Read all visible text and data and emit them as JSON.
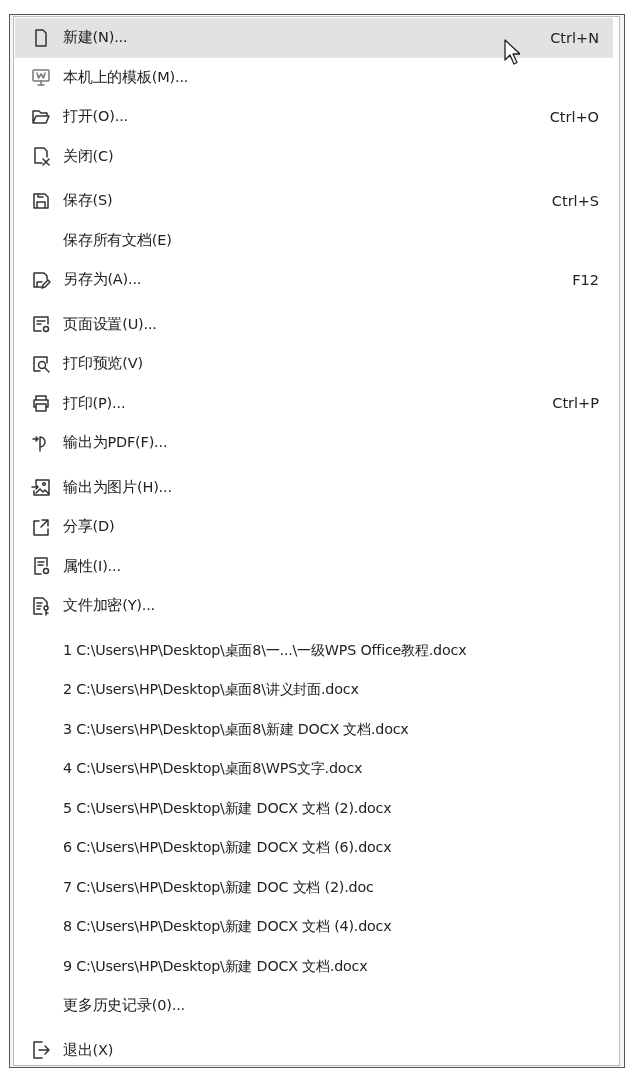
{
  "menu": {
    "sections": [
      {
        "items": [
          {
            "kind": "command",
            "label": "新建(N)...",
            "shortcut": "Ctrl+N",
            "selected": true
          },
          {
            "kind": "command",
            "label": "本机上的模板(M)...",
            "selected": false
          },
          {
            "kind": "command",
            "label": "打开(O)...",
            "shortcut": "Ctrl+O",
            "selected": false
          },
          {
            "kind": "command",
            "label": "关闭(C)",
            "selected": false
          }
        ]
      },
      {
        "items": [
          {
            "kind": "command",
            "label": "保存(S)",
            "shortcut": "Ctrl+S",
            "selected": false
          },
          {
            "kind": "command",
            "label": "保存所有文档(E)",
            "selected": false
          },
          {
            "kind": "command",
            "label": "另存为(A)...",
            "shortcut": "F12",
            "selected": false
          }
        ]
      },
      {
        "items": [
          {
            "kind": "command",
            "label": "页面设置(U)...",
            "selected": false
          },
          {
            "kind": "command",
            "label": "打印预览(V)",
            "selected": false
          },
          {
            "kind": "command",
            "label": "打印(P)...",
            "shortcut": "Ctrl+P",
            "selected": false
          },
          {
            "kind": "command",
            "label": "输出为PDF(F)...",
            "selected": false
          }
        ]
      },
      {
        "items": [
          {
            "kind": "command",
            "label": "输出为图片(H)...",
            "selected": false
          },
          {
            "kind": "command",
            "label": "分享(D)",
            "selected": false
          },
          {
            "kind": "command",
            "label": "属性(I)...",
            "selected": false
          },
          {
            "kind": "command",
            "label": "文件加密(Y)...",
            "selected": false
          }
        ]
      },
      {
        "items": [
          {
            "kind": "recent",
            "label": "1 C:\\Users\\HP\\Desktop\\桌面8\\一...\\一级WPS Office教程.docx",
            "selected": false
          },
          {
            "kind": "recent",
            "label": "2 C:\\Users\\HP\\Desktop\\桌面8\\讲义封面.docx",
            "selected": false
          },
          {
            "kind": "recent",
            "label": "3 C:\\Users\\HP\\Desktop\\桌面8\\新建 DOCX 文档.docx",
            "selected": false
          },
          {
            "kind": "recent",
            "label": "4 C:\\Users\\HP\\Desktop\\桌面8\\WPS文字.docx",
            "selected": false
          },
          {
            "kind": "recent",
            "label": "5 C:\\Users\\HP\\Desktop\\新建 DOCX 文档 (2).docx",
            "selected": false
          },
          {
            "kind": "recent",
            "label": "6 C:\\Users\\HP\\Desktop\\新建 DOCX 文档 (6).docx",
            "selected": false
          },
          {
            "kind": "recent",
            "label": "7 C:\\Users\\HP\\Desktop\\新建 DOC 文档 (2).doc",
            "selected": false
          },
          {
            "kind": "recent",
            "label": "8 C:\\Users\\HP\\Desktop\\新建 DOCX 文档 (4).docx",
            "selected": false
          },
          {
            "kind": "recent",
            "label": "9 C:\\Users\\HP\\Desktop\\新建 DOCX 文档.docx",
            "selected": false
          },
          {
            "kind": "command",
            "label": "更多历史记录(0)...",
            "selected": false
          }
        ]
      },
      {
        "items": [
          {
            "kind": "command",
            "label": "退出(X)",
            "selected": false
          }
        ]
      }
    ]
  }
}
